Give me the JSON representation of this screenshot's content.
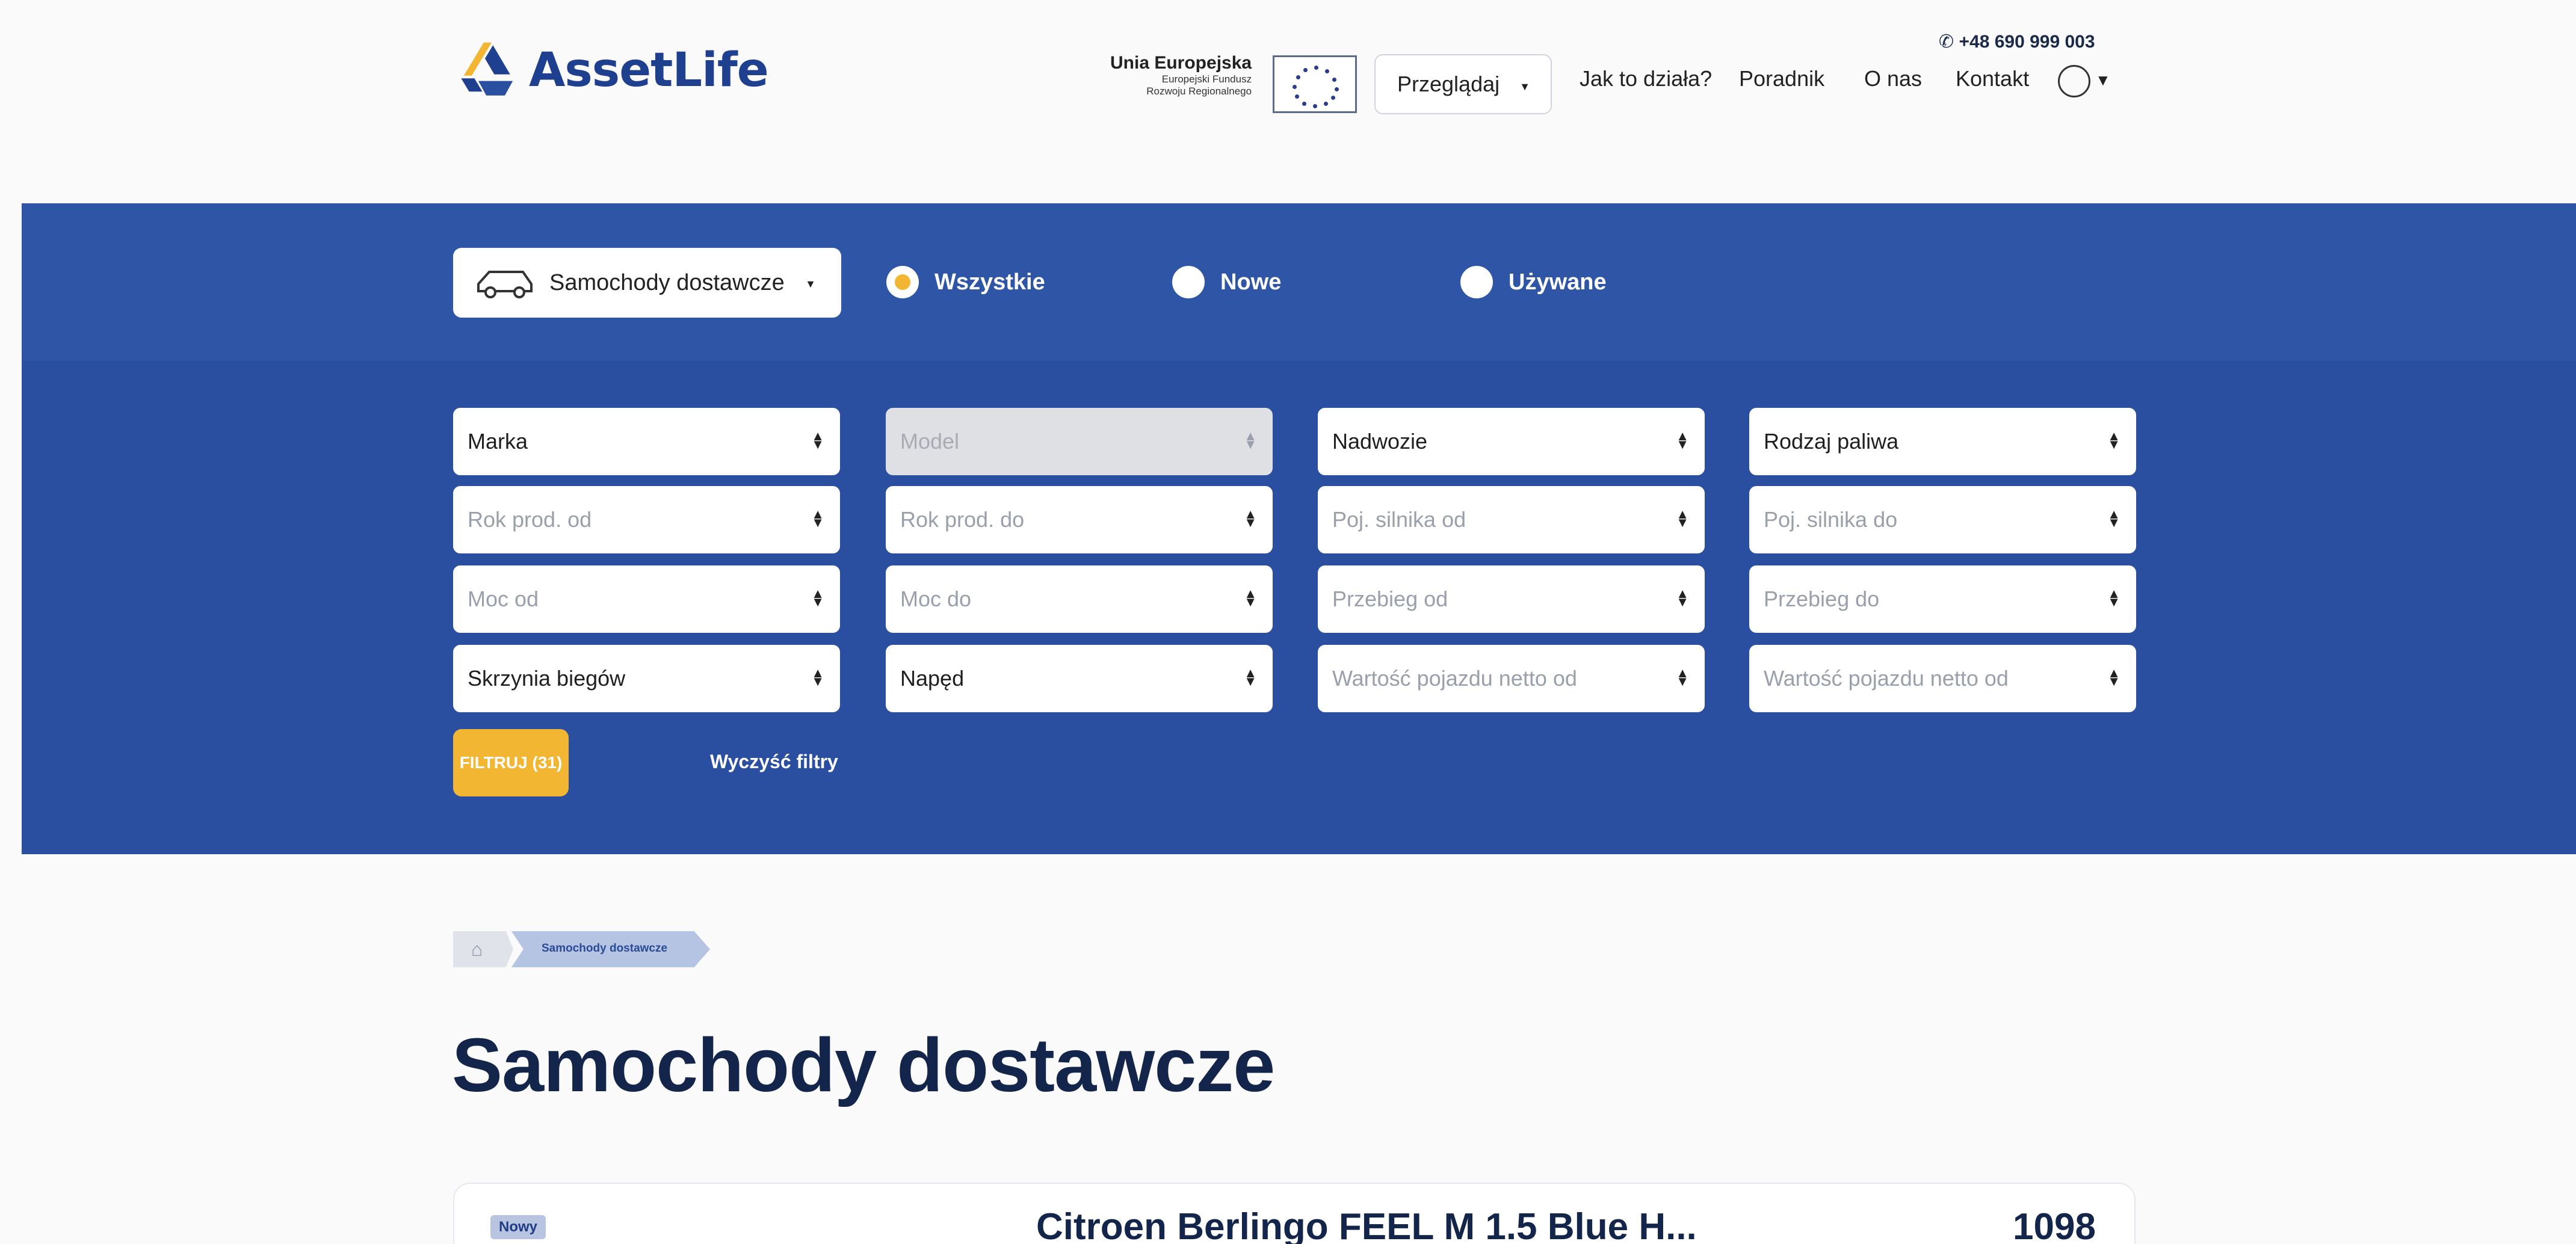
{
  "brand": {
    "name": "AssetLife"
  },
  "eu": {
    "title": "Unia Europejska",
    "line1": "Europejski Fundusz",
    "line2": "Rozwoju Regionalnego"
  },
  "header": {
    "phone": "+48 690 999 003",
    "browse_label": "Przeglądaj",
    "nav": [
      "Jak to działa?",
      "Poradnik",
      "O nas",
      "Kontakt"
    ]
  },
  "search": {
    "vehicle_type": "Samochody dostawcze",
    "condition": [
      {
        "label": "Wszystkie",
        "selected": true
      },
      {
        "label": "Nowe",
        "selected": false
      },
      {
        "label": "Używane",
        "selected": false
      }
    ],
    "filters": [
      "Marka",
      "Model",
      "Nadwozie",
      "Rodzaj paliwa",
      "Rok prod. od",
      "Rok prod. do",
      "Poj. silnika od",
      "Poj. silnika do",
      "Moc od",
      "Moc do",
      "Przebieg od",
      "Przebieg do",
      "Skrzynia biegów",
      "Napęd",
      "Wartość pojazdu netto od",
      "Wartość pojazdu netto od"
    ],
    "filter_button": "FILTRUJ (31)",
    "clear_button": "Wyczyść filtry"
  },
  "breadcrumb": {
    "current": "Samochody dostawcze"
  },
  "page": {
    "title": "Samochody dostawcze"
  },
  "listing": {
    "badge": "Nowy",
    "title": "Citroen Berlingo FEEL M 1.5 Blue H...",
    "price": "1098"
  },
  "colors": {
    "primary_band": "#2f56a6",
    "accent": "#f2b632",
    "brand_text": "#1f3f8f"
  }
}
